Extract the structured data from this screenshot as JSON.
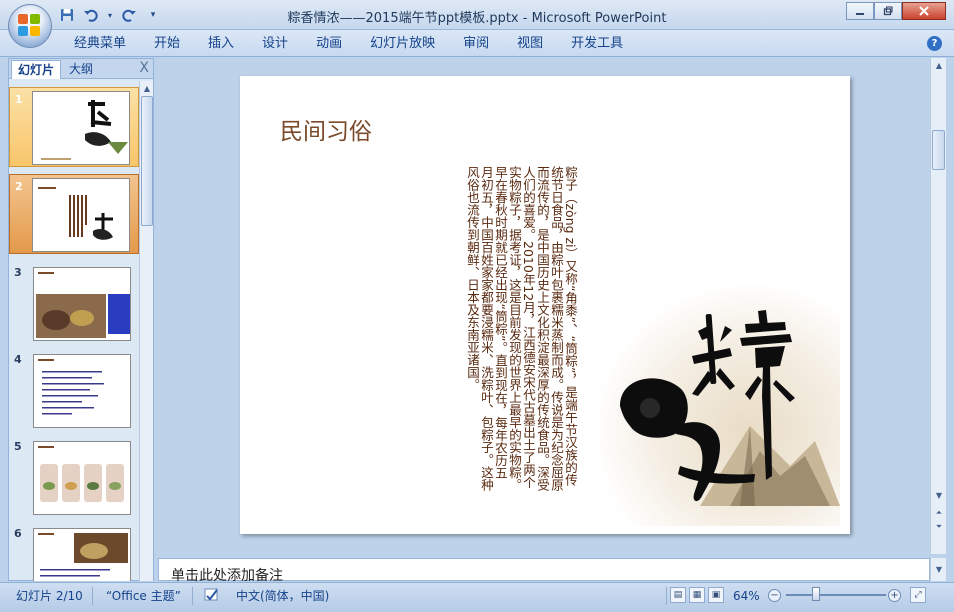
{
  "window": {
    "title": "粽香情浓——2015端午节ppt模板.pptx - Microsoft PowerPoint",
    "minimize_icon": "minimize-icon",
    "maximize_icon": "restore-icon",
    "close_icon": "close-icon"
  },
  "quick_access": {
    "save_icon": "save-icon",
    "undo_icon": "undo-icon",
    "redo_icon": "redo-icon",
    "customize_icon": "chevron-down-icon"
  },
  "ribbon": {
    "tabs": [
      "经典菜单",
      "开始",
      "插入",
      "设计",
      "动画",
      "幻灯片放映",
      "审阅",
      "视图",
      "开发工具"
    ],
    "help_label": "?"
  },
  "left_pane": {
    "tab_slides": "幻灯片",
    "tab_outline": "大纲",
    "close_label": "X",
    "thumbnails": [
      {
        "num": "1",
        "selected": false
      },
      {
        "num": "2",
        "selected": true
      },
      {
        "num": "3",
        "selected": false
      },
      {
        "num": "4",
        "selected": false
      },
      {
        "num": "5",
        "selected": false
      },
      {
        "num": "6",
        "selected": false
      }
    ]
  },
  "slide": {
    "title": "民间习俗",
    "body": "粽子（zòng zi）又称“角黍”、“筒粽”，是端午节汉族的传统节日食品，由粽叶包裹糯米蒸制而成。传说是为纪念屈原而流传的，是中国历史上文化积淀最深厚的传统食品。深受人们的喜爱。2010年12月，江西德安宋代古墓出土了两个实物粽子，据考证，这是目前发现的世界上最早的实物粽。早在春秋时期就已经出现“筒粽”。直到现在，每年农历五月初五，中国百姓家家都要浸糯米、洗粽叶、包粽子。这种风俗也流传到朝鲜、日本及东南亚诸国。",
    "art_char": "粽"
  },
  "notes": {
    "placeholder": "单击此处添加备注"
  },
  "status": {
    "slide_info": "幻灯片 2/10",
    "theme": "“Office 主题”",
    "language": "中文(简体，中国)",
    "zoom": "64%",
    "spell_icon": "spellcheck-icon"
  }
}
